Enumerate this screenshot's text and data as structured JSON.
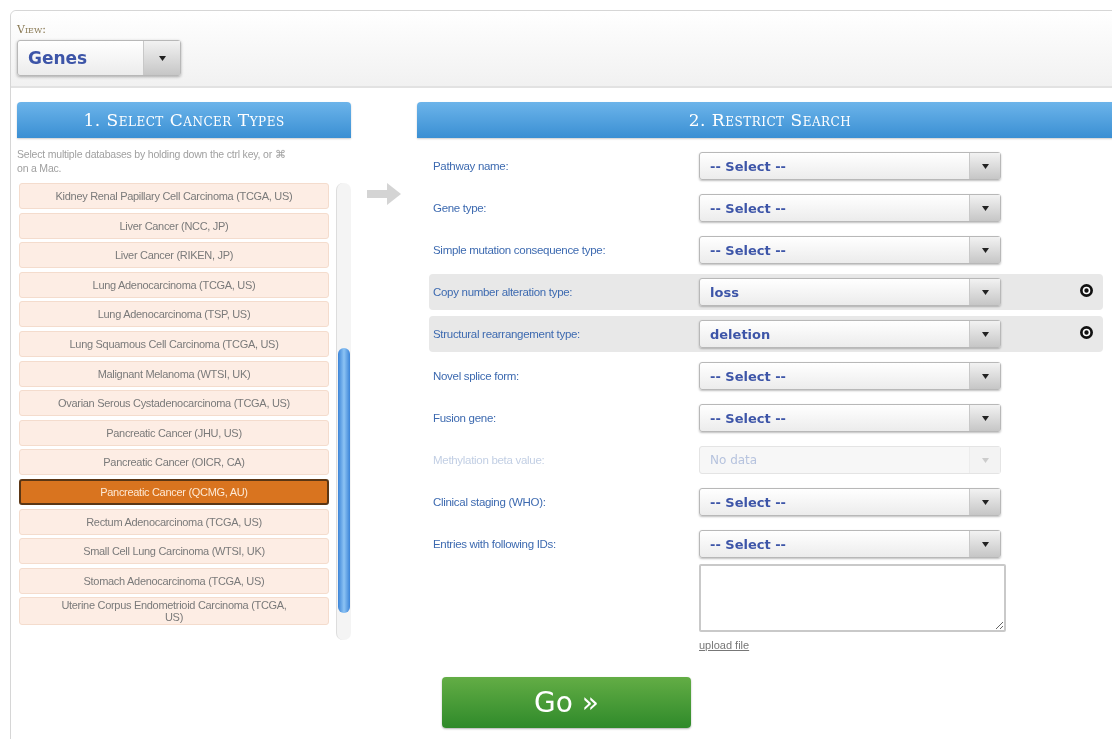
{
  "view": {
    "label": "View:",
    "value": "Genes"
  },
  "cancer_types": {
    "title": "1. Select Cancer Types",
    "help": "Select multiple databases by holding down the ctrl key, or ⌘ on a Mac.",
    "items": [
      {
        "label": "Kidney Renal Papillary Cell Carcinoma (TCGA, US)",
        "selected": false
      },
      {
        "label": "Liver Cancer (NCC, JP)",
        "selected": false
      },
      {
        "label": "Liver Cancer (RIKEN, JP)",
        "selected": false
      },
      {
        "label": "Lung Adenocarcinoma (TCGA, US)",
        "selected": false
      },
      {
        "label": "Lung Adenocarcinoma (TSP, US)",
        "selected": false
      },
      {
        "label": "Lung Squamous Cell Carcinoma (TCGA, US)",
        "selected": false
      },
      {
        "label": "Malignant Melanoma (WTSI, UK)",
        "selected": false
      },
      {
        "label": "Ovarian Serous Cystadenocarcinoma (TCGA, US)",
        "selected": false
      },
      {
        "label": "Pancreatic Cancer (JHU, US)",
        "selected": false
      },
      {
        "label": "Pancreatic Cancer (OICR, CA)",
        "selected": false
      },
      {
        "label": "Pancreatic Cancer (QCMG, AU)",
        "selected": true
      },
      {
        "label": "Rectum Adenocarcinoma (TCGA, US)",
        "selected": false
      },
      {
        "label": "Small Cell Lung Carcinoma (WTSI, UK)",
        "selected": false
      },
      {
        "label": "Stomach Adenocarcinoma (TCGA, US)",
        "selected": false
      },
      {
        "label": "Uterine Corpus Endometrioid Carcinoma (TCGA, US)",
        "selected": false
      }
    ]
  },
  "restrict_search": {
    "title": "2. Restrict Search",
    "filters": [
      {
        "label": "Pathway name:",
        "value": "-- Select --",
        "disabled": false,
        "removable": false
      },
      {
        "label": "Gene type:",
        "value": "-- Select --",
        "disabled": false,
        "removable": false
      },
      {
        "label": "Simple mutation consequence type:",
        "value": "-- Select --",
        "disabled": false,
        "removable": false
      },
      {
        "label": "Copy number alteration type:",
        "value": "loss",
        "disabled": false,
        "removable": true
      },
      {
        "label": "Structural rearrangement type:",
        "value": "deletion",
        "disabled": false,
        "removable": true
      },
      {
        "label": "Novel splice form:",
        "value": "-- Select --",
        "disabled": false,
        "removable": false
      },
      {
        "label": "Fusion gene:",
        "value": "-- Select --",
        "disabled": false,
        "removable": false
      },
      {
        "label": "Methylation beta value:",
        "value": "No data",
        "disabled": true,
        "removable": false
      },
      {
        "label": "Clinical staging (WHO):",
        "value": "-- Select --",
        "disabled": false,
        "removable": false
      },
      {
        "label": "Entries with following IDs:",
        "value": "-- Select --",
        "disabled": false,
        "removable": false
      }
    ],
    "upload_link": "upload file"
  },
  "go_button": "Go »"
}
